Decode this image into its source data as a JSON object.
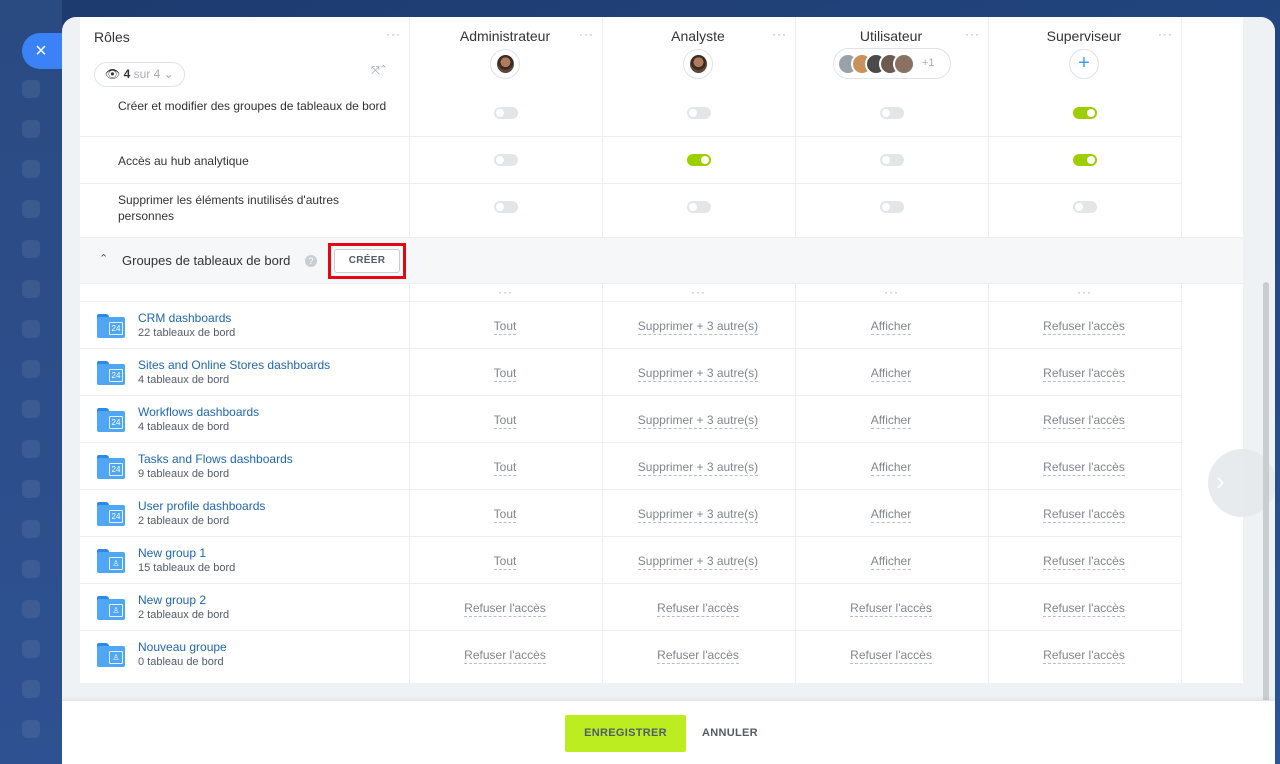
{
  "close_icon": "×",
  "header": {
    "roles_label": "Rôles",
    "dots": "···",
    "role_count": {
      "icon": "eye-icon",
      "value": "4",
      "suffix": "sur 4"
    },
    "columns": [
      {
        "title": "Administrateur"
      },
      {
        "title": "Analyste"
      },
      {
        "title": "Utilisateur",
        "extra_members": "+1"
      },
      {
        "title": "Superviseur"
      }
    ],
    "add_symbol": "+"
  },
  "permissions": [
    {
      "label": "Créer et modifier des groupes de tableaux de bord",
      "toggles": [
        false,
        false,
        false,
        true
      ]
    },
    {
      "label": "Accès au hub analytique",
      "toggles": [
        false,
        true,
        false,
        true
      ]
    },
    {
      "label": "Supprimer les éléments inutilisés d'autres personnes",
      "toggles": [
        false,
        false,
        false,
        false
      ]
    }
  ],
  "section": {
    "title": "Groupes de tableaux de bord",
    "help": "?",
    "create_label": "CRÉER"
  },
  "groups": [
    {
      "name": "CRM dashboards",
      "count": "22 tableaux de bord",
      "icon": "folder-24-icon",
      "cells": [
        "Tout",
        "Supprimer + 3 autre(s)",
        "Afficher",
        "Refuser l'accès"
      ]
    },
    {
      "name": "Sites and Online Stores dashboards",
      "count": "4 tableaux de bord",
      "icon": "folder-24-icon",
      "cells": [
        "Tout",
        "Supprimer + 3 autre(s)",
        "Afficher",
        "Refuser l'accès"
      ]
    },
    {
      "name": "Workflows dashboards",
      "count": "4 tableaux de bord",
      "icon": "folder-24-icon",
      "cells": [
        "Tout",
        "Supprimer + 3 autre(s)",
        "Afficher",
        "Refuser l'accès"
      ]
    },
    {
      "name": "Tasks and Flows dashboards",
      "count": "9 tableaux de bord",
      "icon": "folder-24-icon",
      "cells": [
        "Tout",
        "Supprimer + 3 autre(s)",
        "Afficher",
        "Refuser l'accès"
      ]
    },
    {
      "name": "User profile dashboards",
      "count": "2 tableaux de bord",
      "icon": "folder-24-icon",
      "cells": [
        "Tout",
        "Supprimer + 3 autre(s)",
        "Afficher",
        "Refuser l'accès"
      ]
    },
    {
      "name": "New group 1",
      "count": "15 tableaux de bord",
      "icon": "folder-user-icon",
      "cells": [
        "Tout",
        "Supprimer + 3 autre(s)",
        "Afficher",
        "Refuser l'accès"
      ]
    },
    {
      "name": "New group 2",
      "count": "2 tableaux de bord",
      "icon": "folder-user-icon",
      "cells": [
        "Refuser l'accès",
        "Refuser l'accès",
        "Refuser l'accès",
        "Refuser l'accès"
      ]
    },
    {
      "name": "Nouveau groupe",
      "count": "0 tableau de bord",
      "icon": "folder-user-icon",
      "cells": [
        "Refuser l'accès",
        "Refuser l'accès",
        "Refuser l'accès",
        "Refuser l'accès"
      ]
    }
  ],
  "footer": {
    "save_label": "ENREGISTRER",
    "cancel_label": "ANNULER"
  },
  "colors": {
    "accent_blue": "#3b82f6",
    "toggle_on": "#9dcf00",
    "save_button": "#bbed21",
    "highlight_box": "#e30613",
    "link": "#2067b0"
  }
}
